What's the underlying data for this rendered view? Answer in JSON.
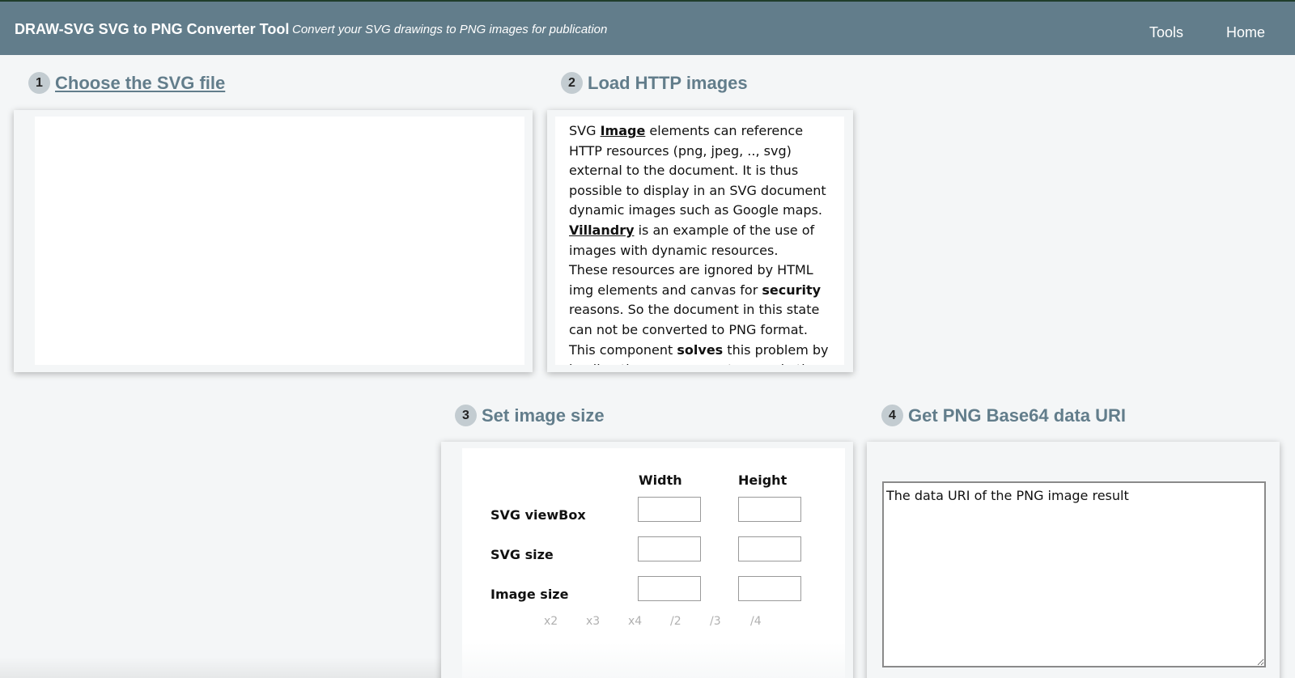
{
  "header": {
    "brand": "DRAW-SVG SVG to PNG Converter Tool",
    "tagline": "Convert your SVG drawings to PNG images for publication",
    "nav": {
      "tools": "Tools",
      "home": "Home"
    },
    "bg_color": "#627d8b"
  },
  "steps": {
    "choose": {
      "num": "1",
      "title": "Choose the SVG file"
    },
    "load": {
      "num": "2",
      "title": "Load HTTP images"
    },
    "size": {
      "num": "3",
      "title": "Set image size"
    },
    "uri": {
      "num": "4",
      "title": "Get PNG Base64 data URI"
    }
  },
  "load_text": {
    "p1_a": "SVG ",
    "p1_link": "Image",
    "p1_b": " elements can reference HTTP resources (png, jpeg, .., svg) external to the document. It is thus possible to display in an SVG document dynamic images such as Google maps.",
    "p2_link": "Villandry",
    "p2_b": " is an example of the use of images with dynamic resources.",
    "p3_a": "These resources are ignored by HTML img elements and canvas for ",
    "p3_bold": "security",
    "p3_b": " reasons. So the document in this state can not be converted to PNG format.",
    "p4_a": "This component ",
    "p4_bold": "solves",
    "p4_b": " this problem by loading these resources to encode them"
  },
  "size_table": {
    "col_width": "Width",
    "col_height": "Height",
    "rows": {
      "viewbox": "SVG viewBox",
      "svgsize": "SVG size",
      "imagesize": "Image size"
    },
    "multipliers": [
      "x2",
      "x3",
      "x4",
      "/2",
      "/3",
      "/4"
    ]
  },
  "uri": {
    "placeholder": "The data URI of the PNG image result"
  }
}
